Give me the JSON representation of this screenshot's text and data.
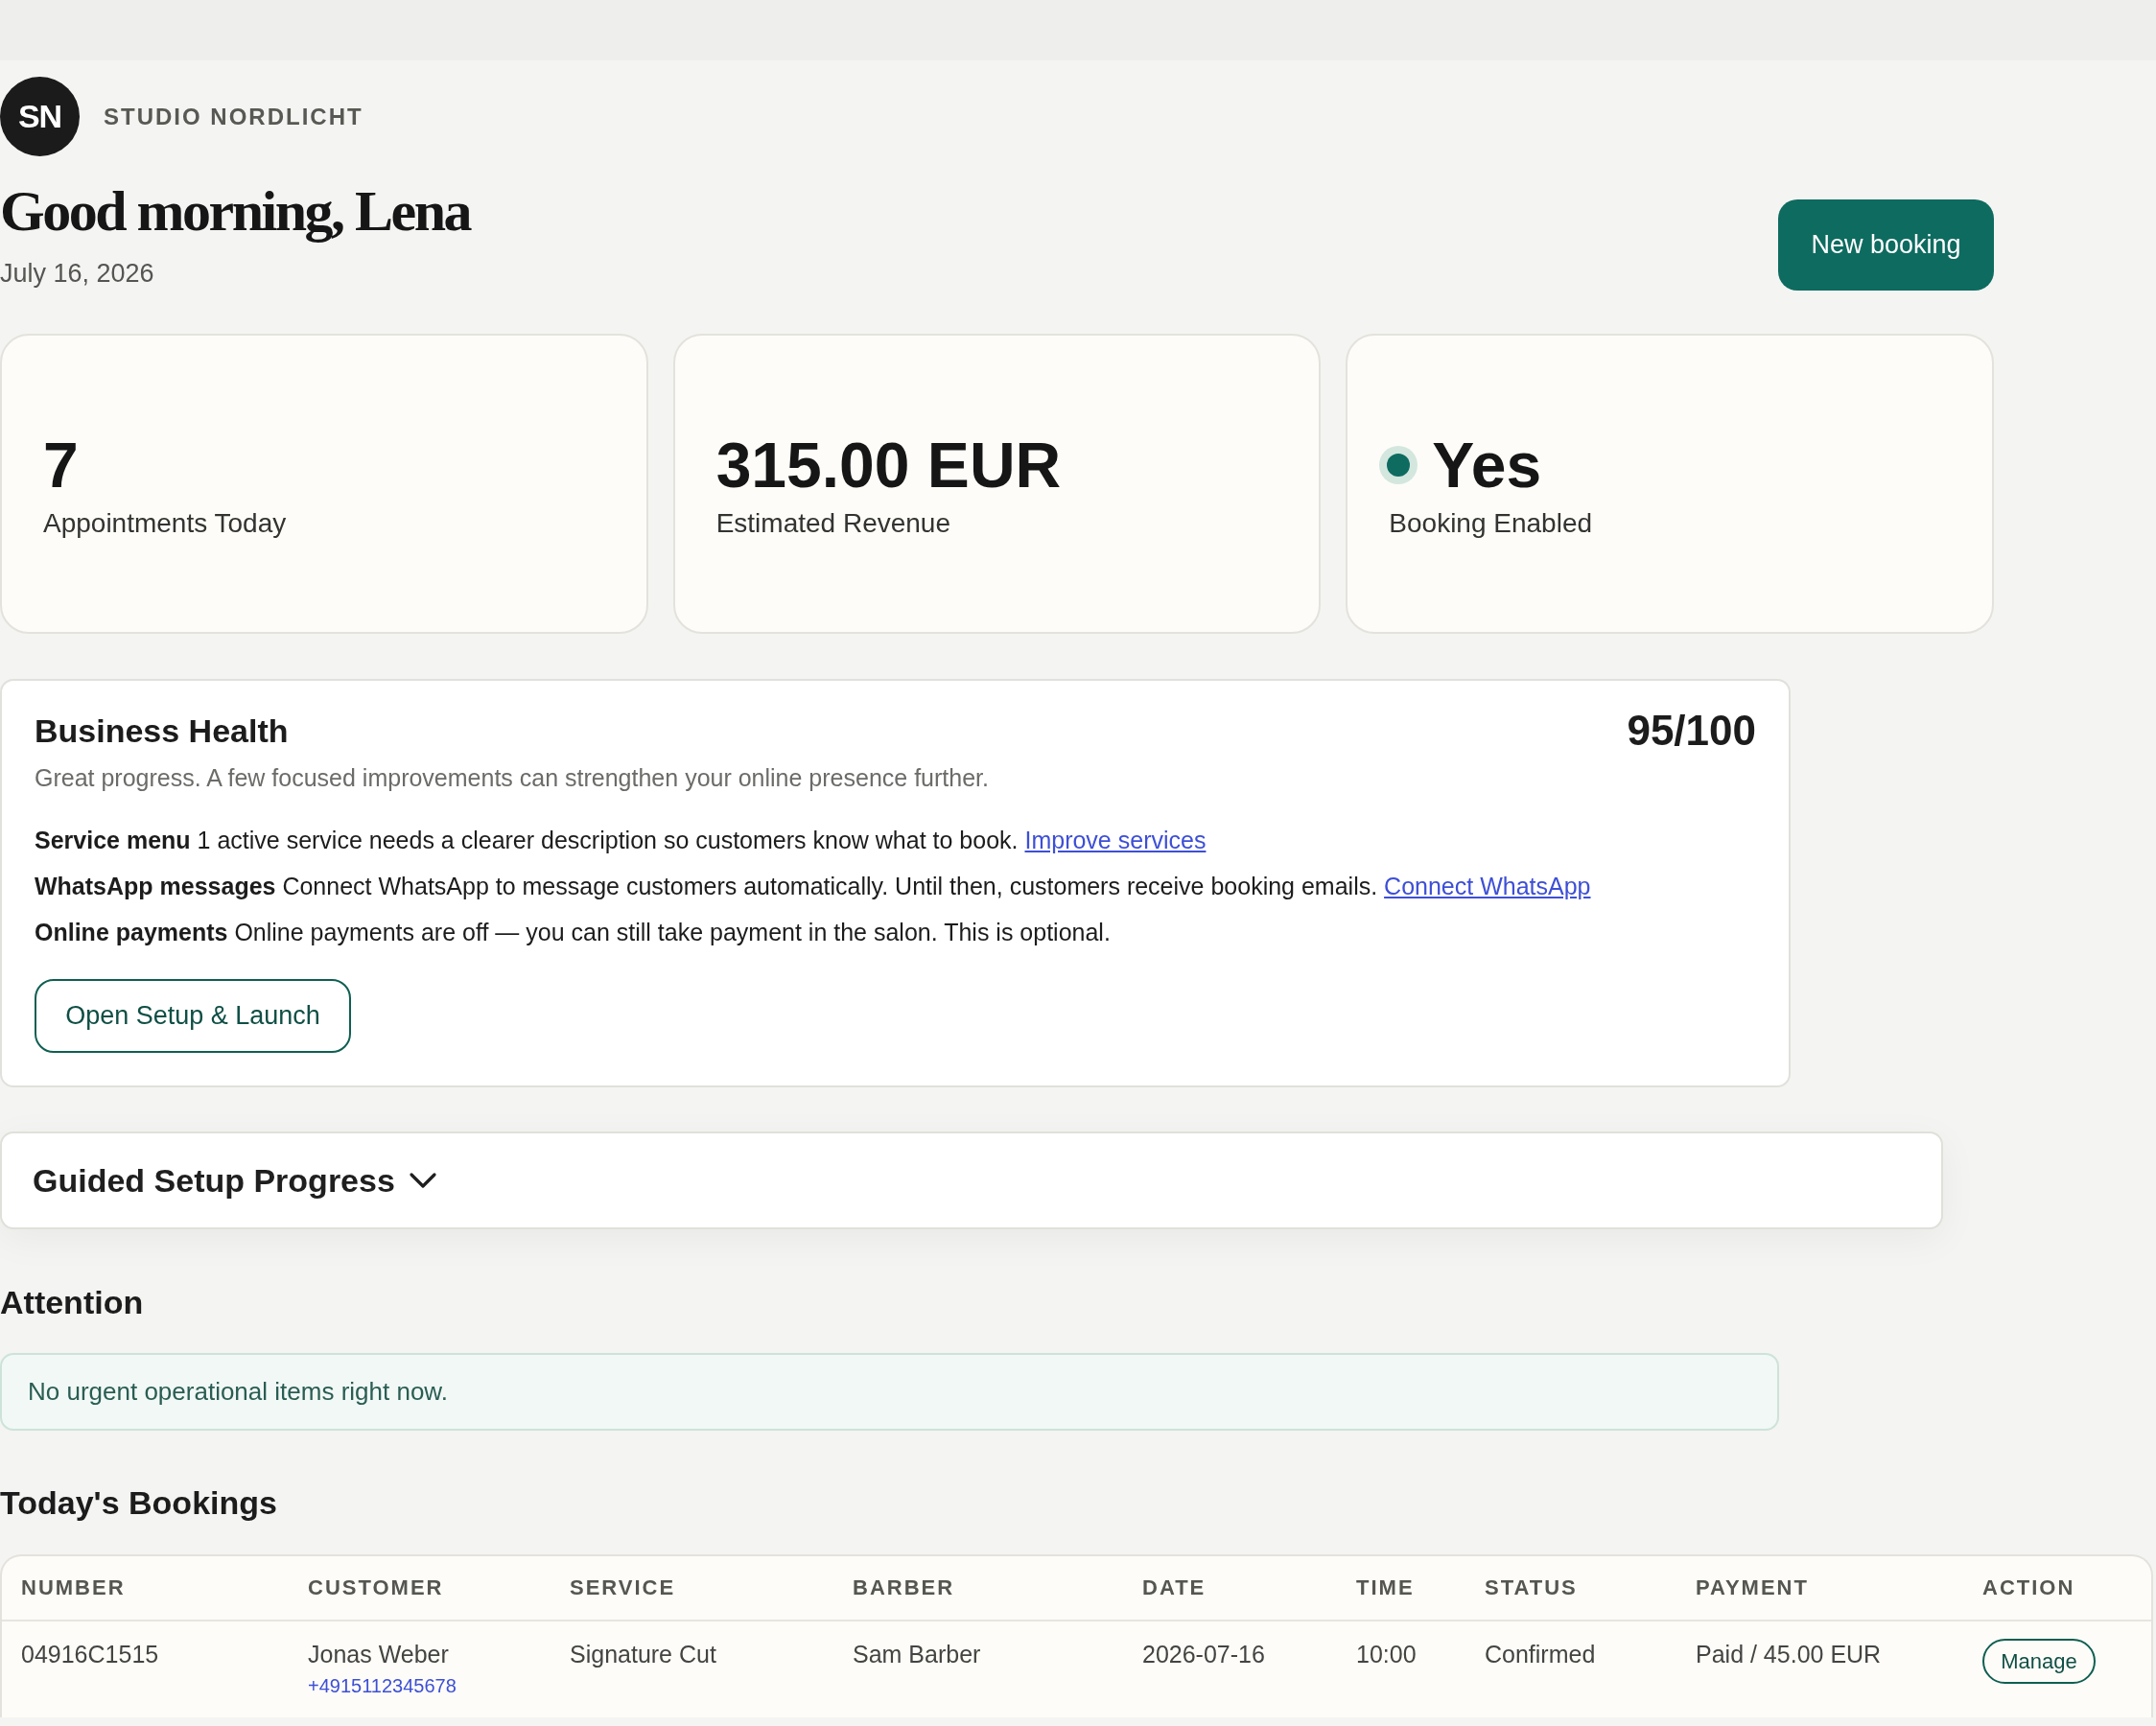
{
  "brand": {
    "initials": "SN",
    "name": "STUDIO NORDLICHT"
  },
  "greeting": {
    "title": "Good morning, Lena",
    "date": "July 16, 2026"
  },
  "primary_action": {
    "label": "New booking"
  },
  "stats": [
    {
      "kind": "plain",
      "value": "7",
      "label": "Appointments Today"
    },
    {
      "kind": "plain",
      "value": "315.00 EUR",
      "label": "Estimated Revenue"
    },
    {
      "kind": "status",
      "on": true,
      "value": "Yes",
      "label": "Booking Enabled"
    }
  ],
  "business_health": {
    "title": "Business Health",
    "score": "95/100",
    "summary": "Great progress. A few focused improvements can strengthen your online presence further.",
    "items": [
      {
        "text": "**Service menu** 1 active service needs a clearer description so customers know what to book.",
        "link": "Improve services"
      },
      {
        "text": "**WhatsApp messages** Connect WhatsApp to message customers automatically. Until then, customers receive booking emails.",
        "link": "Connect WhatsApp"
      },
      {
        "text": "**Online payments** Online payments are off — you can still take payment in the salon. This is optional."
      }
    ],
    "button": "Open Setup & Launch"
  },
  "guided_setup": {
    "title": "Guided Setup Progress",
    "expanded": false
  },
  "attention": {
    "title": "Attention",
    "message": "No urgent operational items right now."
  },
  "bookings": {
    "title": "Today's Bookings",
    "columns": [
      "NUMBER",
      "CUSTOMER",
      "SERVICE",
      "BARBER",
      "DATE",
      "TIME",
      "STATUS",
      "PAYMENT",
      "ACTION"
    ],
    "rows": [
      {
        "number": "04916C1515",
        "customer": "Jonas Weber",
        "phone": "+4915112345678",
        "service": "Signature Cut",
        "barber": "Sam Barber",
        "date": "2026-07-16",
        "time": "10:00",
        "status": "Confirmed",
        "payment": "Paid / 45.00 EUR",
        "action": "Manage"
      }
    ]
  }
}
